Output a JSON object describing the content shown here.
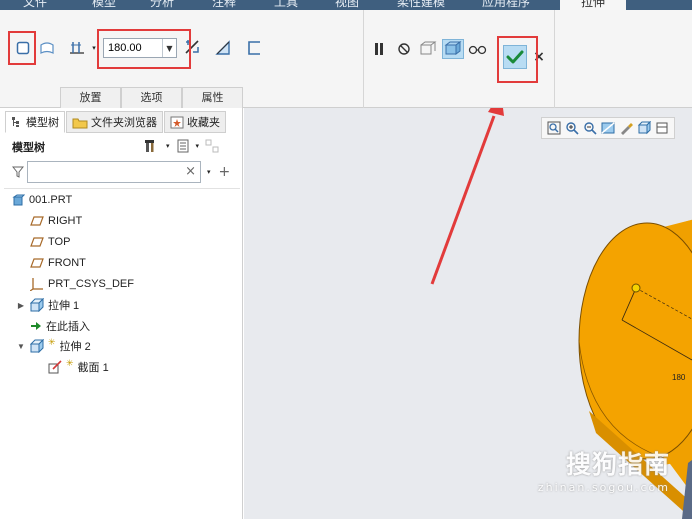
{
  "ribbon": {
    "tabs": [
      "文件",
      "模型",
      "分析",
      "注释",
      "工具",
      "视图",
      "柔性建模",
      "应用程序",
      "拉伸"
    ]
  },
  "dashboard": {
    "depth_value": "180.00",
    "subtabs": [
      "放置",
      "选项",
      "属性"
    ],
    "confirm_icon": "check-icon",
    "cancel_label": "×",
    "accent_color": "#e23b3b"
  },
  "left_panel": {
    "tabs": [
      "模型树",
      "文件夹浏览器",
      "收藏夹"
    ],
    "tree_title": "模型树",
    "filter_placeholder": "",
    "tree": [
      {
        "label": "001.PRT",
        "icon": "part-icon"
      },
      {
        "label": "RIGHT",
        "icon": "datum-plane-icon"
      },
      {
        "label": "TOP",
        "icon": "datum-plane-icon"
      },
      {
        "label": "FRONT",
        "icon": "datum-plane-icon"
      },
      {
        "label": "PRT_CSYS_DEF",
        "icon": "csys-icon"
      },
      {
        "label": "拉伸 1",
        "icon": "extrude-icon"
      },
      {
        "label": "在此插入",
        "icon": "insert-arrow-icon"
      },
      {
        "label": "拉伸 2",
        "icon": "extrude-icon"
      },
      {
        "label": "截面 1",
        "icon": "sketch-icon"
      }
    ]
  },
  "graphics": {
    "dimension_label": "180",
    "watermark": "搜狗指南",
    "watermark_sub": "zhinan.sogou.com",
    "part_color": "#f0a000"
  }
}
